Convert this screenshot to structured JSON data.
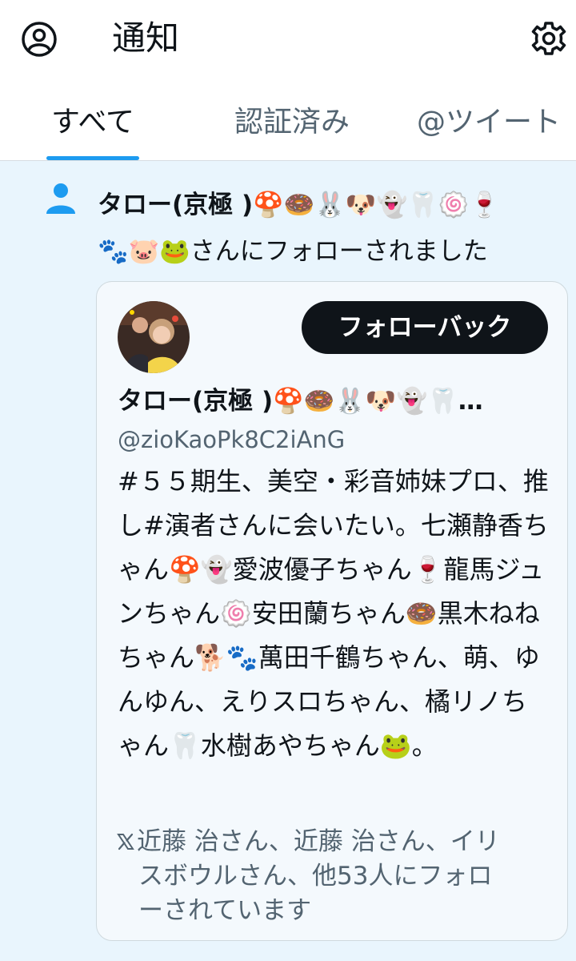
{
  "header": {
    "title": "通知",
    "account_icon": "account-circle-icon",
    "settings_icon": "gear-icon"
  },
  "tabs": [
    {
      "label": "すべて",
      "active": true
    },
    {
      "label": "認証済み",
      "active": false
    },
    {
      "label": "@ツイート",
      "active": false
    }
  ],
  "notification": {
    "icon": "person-icon",
    "name": "タロー(京極 )🍄🍩🐰🐶👻🦷🍥🍷",
    "name_cont": "🐾🐷🐸",
    "action": "さんにフォローされました",
    "card": {
      "follow_button": "フォローバック",
      "display_name": "タロー(京極 )🍄🍩🐰🐶👻🦷…",
      "handle": "@zioKaoPk8C2iAnG",
      "bio": "#５５期生、美空・彩音姉妹プロ、推し#演者さんに会いたい。七瀬静香ちゃん🍄👻愛波優子ちゃん🍷龍馬ジュンちゃん🍥安田蘭ちゃん🍩黒木ねねちゃん🐕🐾萬田千鶴ちゃん、萌、ゆんゆん、えりスロちゃん、橘リノちゃん🦷水樹あやちゃん🐸。",
      "followed_by_line1": "近藤 治さん、近藤 治さん、イリ",
      "followed_by_line2": "スボウルさん、他53人にフォロ",
      "followed_by_line3": "ーされています"
    }
  },
  "colors": {
    "accent": "#1d9bf0",
    "notification_bg": "#e9f5fd",
    "secondary_text": "#536471",
    "button_bg": "#0f1419"
  }
}
